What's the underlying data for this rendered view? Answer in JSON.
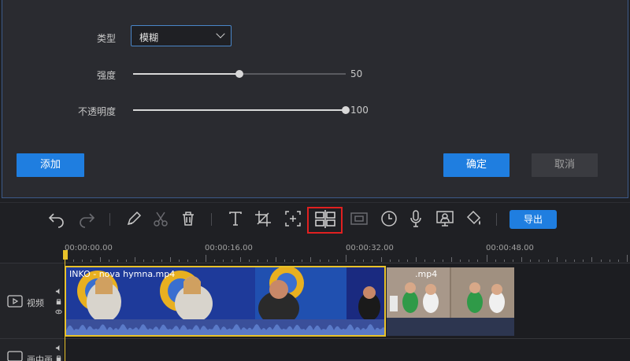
{
  "dialog": {
    "type_label": "类型",
    "type_value": "模糊",
    "strength_label": "强度",
    "strength_value": "50",
    "strength_fraction": 0.5,
    "opacity_label": "不透明度",
    "opacity_value": "100",
    "opacity_fraction": 1.0,
    "add_label": "添加",
    "confirm_label": "确定",
    "cancel_label": "取消"
  },
  "toolbar": {
    "export_label": "导出",
    "icons": [
      "undo-icon",
      "redo-icon",
      "pen-icon",
      "scissors-icon",
      "trash-icon",
      "text-icon",
      "crop-icon",
      "add-frame-icon",
      "mosaic-grid-icon",
      "frame-rect-icon",
      "clock-icon",
      "microphone-icon",
      "screen-record-icon",
      "fill-icon"
    ]
  },
  "timeline": {
    "ticks": [
      "00:00:00.00",
      "00:00:16.00",
      "00:00:32.00",
      "00:00:48.00"
    ],
    "tracks": [
      {
        "label": "视频"
      },
      {
        "label": "画中画"
      }
    ],
    "clips": [
      {
        "name": "INKO - nova hymna.mp4"
      },
      {
        "name": ".mp4"
      }
    ]
  },
  "colors": {
    "accent": "#1f7ee0",
    "playhead": "#e8c22a",
    "highlight": "#e02020"
  }
}
